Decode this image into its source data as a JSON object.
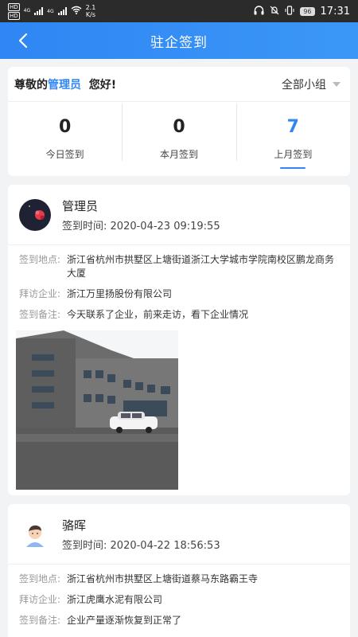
{
  "status_bar": {
    "sim1": "HD",
    "sim2": "HD",
    "net1": "4G",
    "net2": "4G",
    "speed_value": "2.1",
    "speed_unit": "K/s",
    "battery": "96",
    "time": "17:31"
  },
  "nav": {
    "title": "驻企签到"
  },
  "summary": {
    "greeting_prefix": "尊敬的",
    "greeting_name": "管理员",
    "greeting_suffix": "您好!",
    "group_filter": "全部小组",
    "stats": [
      {
        "value": "0",
        "label": "今日签到",
        "active": false
      },
      {
        "value": "0",
        "label": "本月签到",
        "active": false
      },
      {
        "value": "7",
        "label": "上月签到",
        "active": true
      }
    ]
  },
  "records": [
    {
      "name": "管理员",
      "time_label": "签到时间:",
      "time": "2020-04-23 09:19:55",
      "fields": [
        {
          "key": "签到地点:",
          "value": "浙江省杭州市拱墅区上塘街道浙江大学城市学院南校区鹏龙商务大厦"
        },
        {
          "key": "拜访企业:",
          "value": "浙江万里扬股份有限公司"
        },
        {
          "key": "签到备注:",
          "value": "今天联系了企业，前来走访，看下企业情况"
        }
      ]
    },
    {
      "name": "骆晖",
      "time_label": "签到时间:",
      "time": "2020-04-22 18:56:53",
      "fields": [
        {
          "key": "签到地点:",
          "value": "浙江省杭州市拱墅区上塘街道蔡马东路霸王寺"
        },
        {
          "key": "拜访企业:",
          "value": "浙江虎鹰水泥有限公司"
        },
        {
          "key": "签到备注:",
          "value": "企业产量逐渐恢复到正常了"
        }
      ]
    }
  ],
  "colors": {
    "accent": "#2f86f4",
    "background": "#f2f3f5"
  },
  "icons": [
    "back-arrow-icon",
    "caret-down-icon",
    "wifi-icon",
    "headphones-icon",
    "mute-bell-icon",
    "vibrate-icon",
    "battery-icon",
    "signal-icon"
  ]
}
